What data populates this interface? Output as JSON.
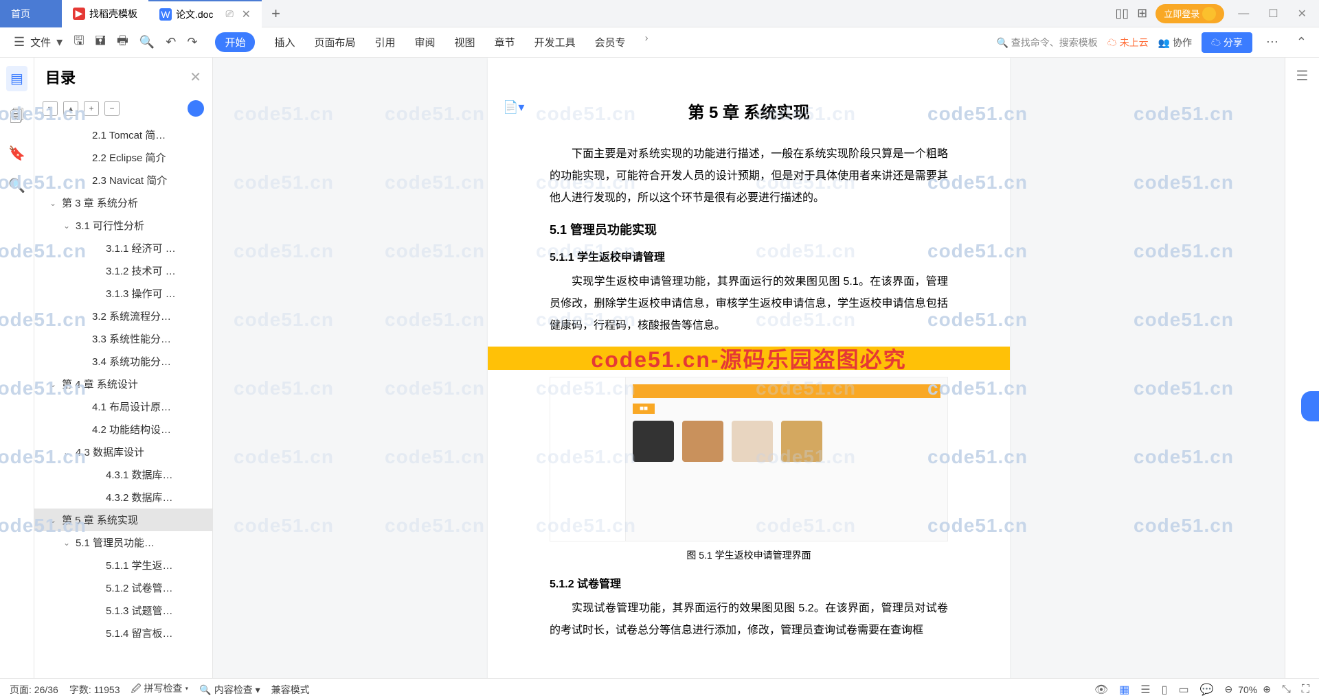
{
  "tabs": {
    "home": "首页",
    "template": "找稻壳模板",
    "doc": "论文.doc"
  },
  "titlebar": {
    "login": "立即登录"
  },
  "toolbar": {
    "file": "文件",
    "menus": [
      "开始",
      "插入",
      "页面布局",
      "引用",
      "审阅",
      "视图",
      "章节",
      "开发工具",
      "会员专"
    ],
    "search": "查找命令、搜索模板",
    "cloud": "未上云",
    "coop": "协作",
    "share": "分享"
  },
  "sidebar": {
    "title": "目录"
  },
  "toc": [
    {
      "lv": 3,
      "t": "2.1 Tomcat  简…"
    },
    {
      "lv": 3,
      "t": "2.2 Eclipse 简介"
    },
    {
      "lv": 3,
      "t": "2.3 Navicat 简介"
    },
    {
      "lv": 1,
      "t": "第 3 章  系统分析",
      "c": true
    },
    {
      "lv": 2,
      "t": "3.1 可行性分析",
      "c": true
    },
    {
      "lv": 4,
      "t": "3.1.1 经济可 …"
    },
    {
      "lv": 4,
      "t": "3.1.2 技术可 …"
    },
    {
      "lv": 4,
      "t": "3.1.3 操作可 …"
    },
    {
      "lv": 3,
      "t": "3.2 系统流程分…"
    },
    {
      "lv": 3,
      "t": "3.3 系统性能分…"
    },
    {
      "lv": 3,
      "t": "3.4 系统功能分…"
    },
    {
      "lv": 1,
      "t": "第 4 章  系统设计",
      "c": true
    },
    {
      "lv": 3,
      "t": "4.1 布局设计原…"
    },
    {
      "lv": 3,
      "t": "4.2 功能结构设…"
    },
    {
      "lv": 2,
      "t": "4.3 数据库设计",
      "c": true
    },
    {
      "lv": 4,
      "t": "4.3.1 数据库…"
    },
    {
      "lv": 4,
      "t": "4.3.2 数据库…"
    },
    {
      "lv": 1,
      "t": "第 5 章  系统实现",
      "c": true,
      "active": true
    },
    {
      "lv": 2,
      "t": "5.1 管理员功能…",
      "c": true
    },
    {
      "lv": 4,
      "t": "5.1.1 学生返…"
    },
    {
      "lv": 4,
      "t": "5.1.2 试卷管…"
    },
    {
      "lv": 4,
      "t": "5.1.3 试题管…"
    },
    {
      "lv": 4,
      "t": "5.1.4 留言板…"
    }
  ],
  "doc": {
    "title": "第 5 章  系统实现",
    "intro": "下面主要是对系统实现的功能进行描述，一般在系统实现阶段只算是一个粗略的功能实现，可能符合开发人员的设计预期，但是对于具体使用者来讲还是需要其他人进行发现的，所以这个环节是很有必要进行描述的。",
    "h2a": "5.1  管理员功能实现",
    "h3a": "5.1.1  学生返校申请管理",
    "p2": "实现学生返校申请管理功能，其界面运行的效果图见图 5.1。在该界面，管理员修改，删除学生返校申请信息，审核学生返校申请信息，学生返校申请信息包括健康码，行程码，核酸报告等信息。",
    "wm": "code51.cn-源码乐园盗图必究",
    "caption": "图 5.1 学生返校申请管理界面",
    "h3b": "5.1.2  试卷管理",
    "p3": "实现试卷管理功能，其界面运行的效果图见图 5.2。在该界面，管理员对试卷的考试时长，试卷总分等信息进行添加，修改，管理员查询试卷需要在查询框"
  },
  "status": {
    "page": "页面: 26/36",
    "words": "字数: 11953",
    "spell": "拼写检查",
    "content": "内容检查",
    "compat": "兼容模式",
    "zoom": "70%"
  },
  "watermark": "code51.cn"
}
